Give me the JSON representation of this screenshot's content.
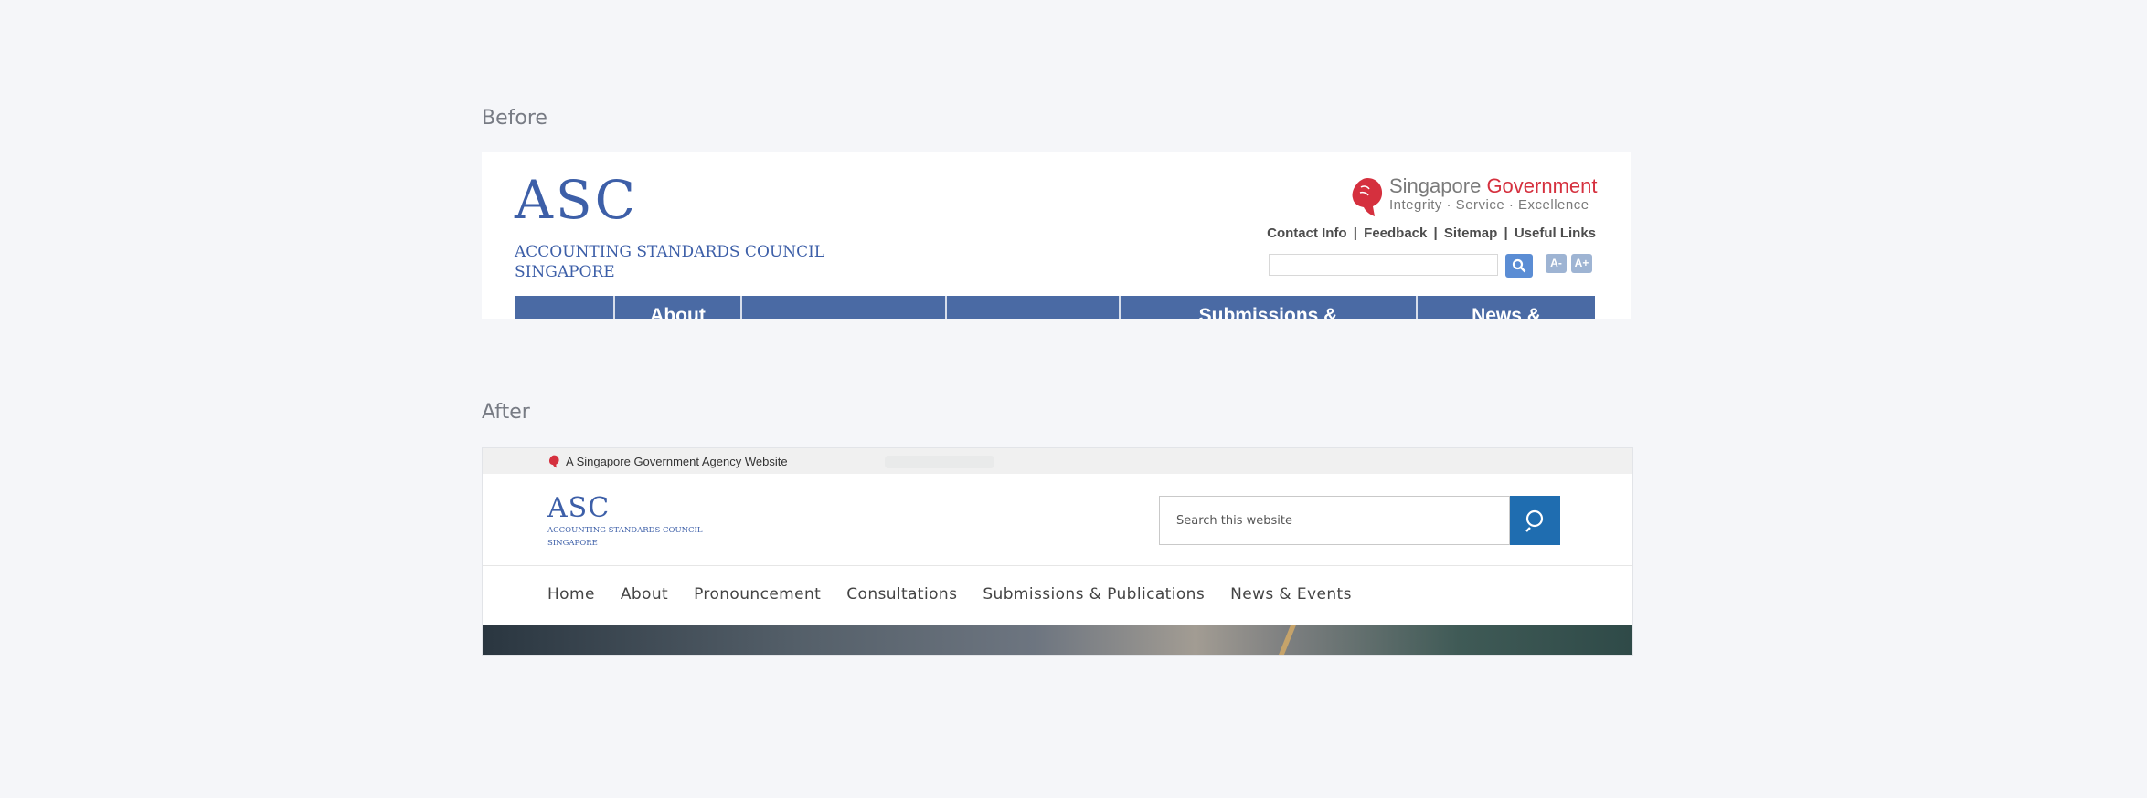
{
  "labels": {
    "before": "Before",
    "after": "After"
  },
  "before": {
    "logo": {
      "mark": "ASC",
      "name_line1": "ACCOUNTING STANDARDS COUNCIL",
      "name_line2": "SINGAPORE"
    },
    "gov_brand": {
      "word1": "Singapore",
      "word2": "Government",
      "tagline": "Integrity · Service · Excellence"
    },
    "links": [
      "Contact Info",
      "Feedback",
      "Sitemap",
      "Useful Links"
    ],
    "link_separator": "|",
    "search": {
      "value": ""
    },
    "font_buttons": {
      "decrease": "A-",
      "increase": "A+"
    },
    "nav": [
      "",
      "About",
      "",
      "",
      "Submissions &",
      "News &"
    ]
  },
  "after": {
    "masthead": "A Singapore Government Agency Website",
    "logo": {
      "mark": "ASC",
      "name_line1": "ACCOUNTING STANDARDS COUNCIL",
      "name_line2": "SINGAPORE"
    },
    "search": {
      "placeholder": "Search this website"
    },
    "nav": [
      "Home",
      "About",
      "Pronouncement",
      "Consultations",
      "Submissions & Publications",
      "News & Events"
    ]
  },
  "colors": {
    "asc_blue": "#3d5fa8",
    "gov_red": "#d5303e",
    "old_nav": "#4a6aa4",
    "new_search_button": "#1f6db0"
  },
  "icons": [
    "lion-head-icon",
    "search-icon"
  ]
}
